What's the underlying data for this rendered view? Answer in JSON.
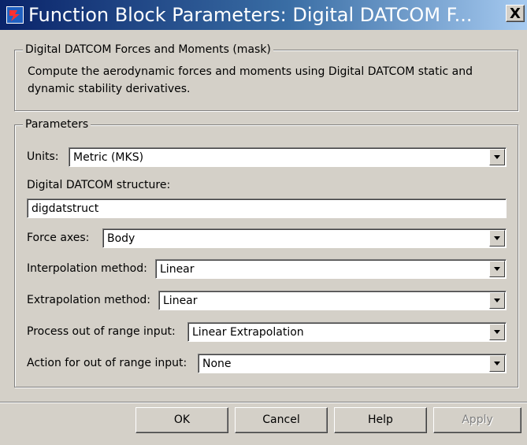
{
  "window": {
    "title": "Function Block Parameters: Digital DATCOM F...",
    "icon": "simulink-block-icon",
    "close_label": "X"
  },
  "mask": {
    "group_label": "Digital DATCOM Forces and Moments (mask)",
    "description": "Compute the aerodynamic forces and moments using Digital DATCOM static and dynamic stability derivatives."
  },
  "parameters": {
    "group_label": "Parameters",
    "units": {
      "label": "Units:",
      "value": "Metric (MKS)"
    },
    "structure": {
      "label": "Digital DATCOM structure:",
      "value": "digdatstruct"
    },
    "force_axes": {
      "label": "Force axes:",
      "value": "Body"
    },
    "interpolation": {
      "label": "Interpolation method:",
      "value": "Linear"
    },
    "extrapolation": {
      "label": "Extrapolation method:",
      "value": "Linear"
    },
    "process_out_of_range": {
      "label": "Process out of range input:",
      "value": "Linear Extrapolation"
    },
    "action_out_of_range": {
      "label": "Action for out of range input:",
      "value": "None"
    }
  },
  "buttons": {
    "ok": "OK",
    "cancel": "Cancel",
    "help": "Help",
    "apply": "Apply"
  },
  "colors": {
    "title_start": "#0a246a",
    "title_end": "#a6caf0",
    "dialog_face": "#d4d0c8"
  }
}
